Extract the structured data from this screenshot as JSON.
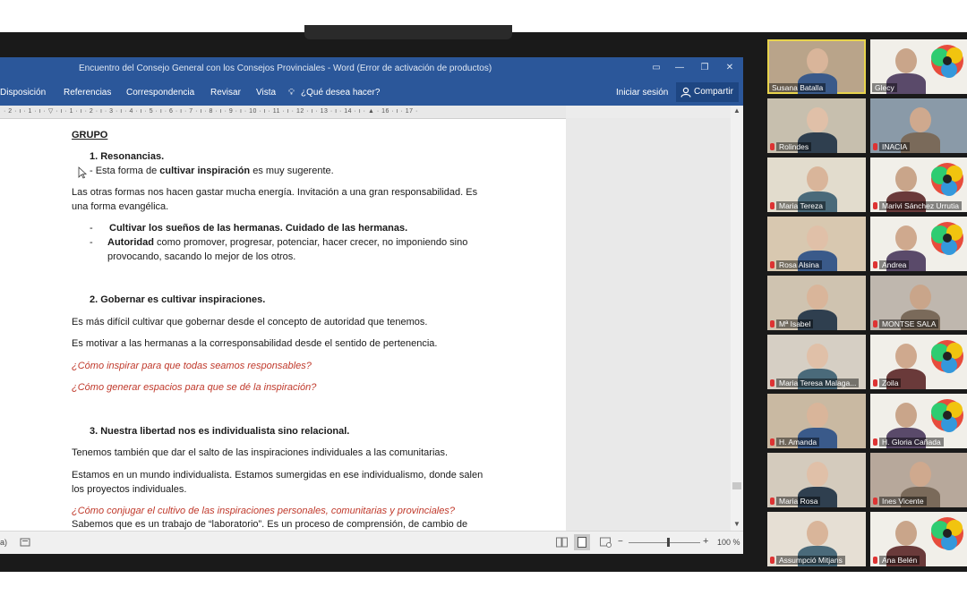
{
  "window": {
    "title": "Encuentro del Consejo General con los Consejos Provinciales - Word (Error de activación de productos)"
  },
  "menu": {
    "items": [
      "Disposición",
      "Referencias",
      "Correspondencia",
      "Revisar",
      "Vista"
    ],
    "search_placeholder": "¿Qué desea hacer?",
    "sign_in": "Iniciar sesión",
    "share": "Compartir"
  },
  "ruler": {
    "labels": "· 2 · ı · 1 · ı · ▽ · ı · 1 · ı · 2 · ı · 3 · ı · 4 · ı · 5 · ı · 6 · ı · 7 · ı · 8 · ı · 9 · ı · 10 · ı · 11 · ı · 12 · ı · 13 · ı · 14 · ı · ▲ · 16 · ı · 17 ·"
  },
  "document": {
    "heading": "GRUPO",
    "s1_title": "1.    Resonancias.",
    "s1_bullet_pre": "-      Esta forma de ",
    "s1_bullet_bold": "cultivar inspiración",
    "s1_bullet_post": " es muy sugerente.",
    "p1_line1": "Las otras formas nos hacen gastar mucha energía. Invitación a una gran responsabilidad. Es",
    "p1_line2": "una forma evangélica.",
    "bullet2": "Cultivar los sueños de las hermanas. Cuidado de las hermanas.",
    "bullet3_bold": "Autoridad",
    "bullet3_rest": " como promover, progresar, potenciar, hacer crecer, no imponiendo sino",
    "bullet3_line2": "provocando, sacando lo mejor de los otros.",
    "s2_title": "2.    Gobernar es cultivar inspiraciones.",
    "p2": "Es más difícil cultivar que gobernar desde el concepto de autoridad que tenemos.",
    "p3": "Es motivar a las hermanas a la corresponsabilidad desde el sentido de pertenencia.",
    "q1": "¿Cómo inspirar para que todas seamos responsables?",
    "q2": "¿Cómo generar espacios para que se dé la inspiración?",
    "s3_title": "3.    Nuestra libertad nos es individualista sino relacional.",
    "p4": "Tenemos también que dar el salto de las inspiraciones individuales a las comunitarias.",
    "p5_line1": "Estamos en un mundo individualista. Estamos sumergidas en ese individualismo, donde salen",
    "p5_line2": "los proyectos individuales.",
    "q3": "¿Cómo conjugar el cultivo de las inspiraciones personales, comunitarias y provinciales?",
    "p6_partial": "Sabemos que es un trabajo de “laboratorio”. Es un proceso de comprensión, de cambio de"
  },
  "status": {
    "left_fragment": "a)",
    "zoom": "100 %",
    "zoom_level": 0.55
  },
  "participants": [
    {
      "name": "Susana Batalla",
      "muted": false
    },
    {
      "name": "Glecy",
      "muted": false
    },
    {
      "name": "Rolindes",
      "muted": true
    },
    {
      "name": "INACIA",
      "muted": true
    },
    {
      "name": "Maria  Tereza",
      "muted": true
    },
    {
      "name": "Marivi Sánchez Urrutia",
      "muted": true
    },
    {
      "name": "Rosa Alsina",
      "muted": true
    },
    {
      "name": "Andrea",
      "muted": true
    },
    {
      "name": "Mª Isabel",
      "muted": true
    },
    {
      "name": "MONTSE SALA",
      "muted": true
    },
    {
      "name": "Maria Teresa Malaga...",
      "muted": true
    },
    {
      "name": "Zoila",
      "muted": true
    },
    {
      "name": "H. Amanda",
      "muted": true
    },
    {
      "name": "H. Gloria Cañada",
      "muted": true
    },
    {
      "name": "Maria Rosa",
      "muted": true
    },
    {
      "name": "Ines Vicente",
      "muted": true
    },
    {
      "name": "Assumpció Mitjans",
      "muted": true
    },
    {
      "name": "Ana Belén",
      "muted": true
    }
  ],
  "colors": {
    "word_blue": "#2b579a",
    "question_red": "#c0392b",
    "active_speaker_border": "#e8d44d"
  }
}
